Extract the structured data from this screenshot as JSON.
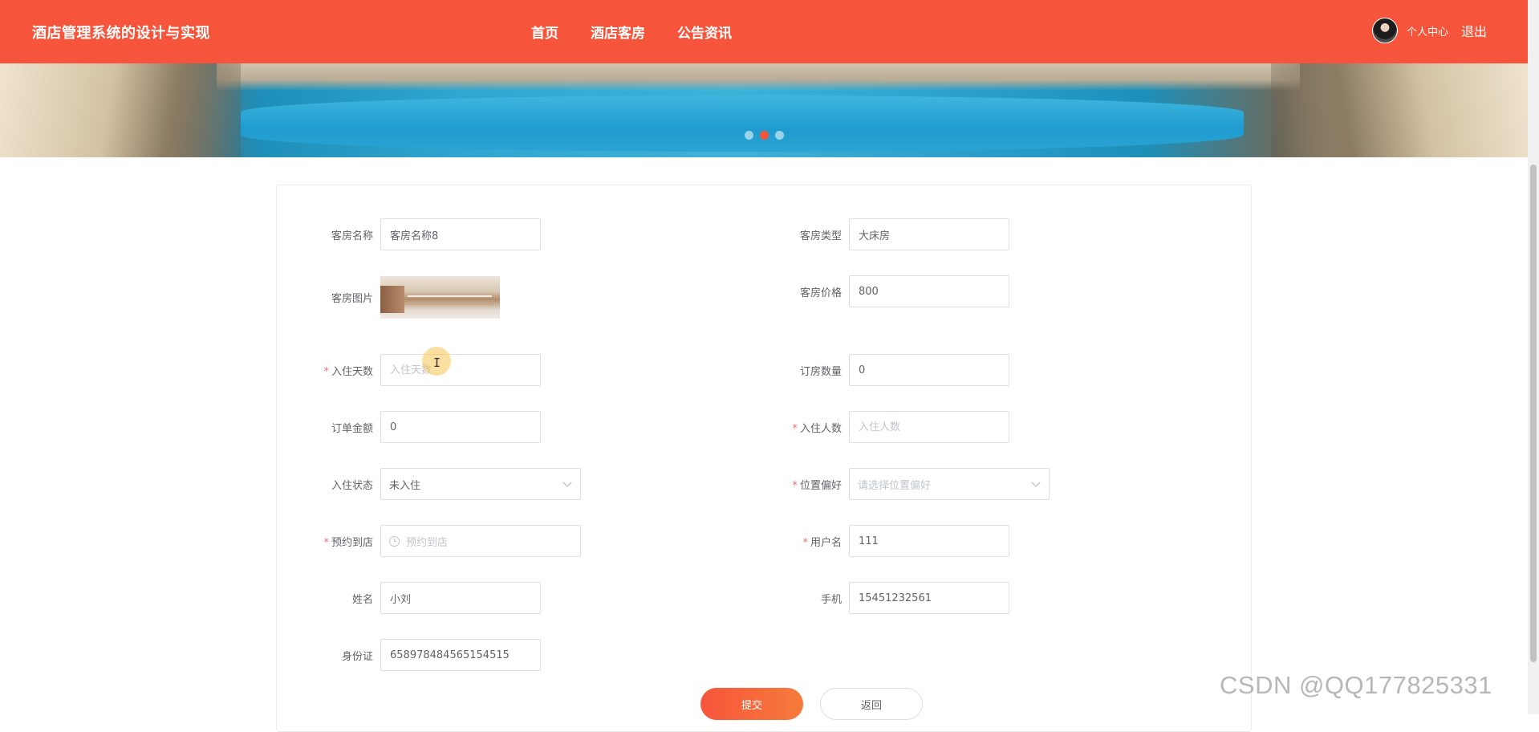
{
  "header": {
    "title": "酒店管理系统的设计与实现",
    "nav": [
      "首页",
      "酒店客房",
      "公告资讯"
    ],
    "user_center": "个人中心",
    "logout": "退出"
  },
  "colors": {
    "primary": "#f6553b",
    "required": "#f56c6c",
    "border": "#dcdfe6",
    "placeholder": "#c0c4cc"
  },
  "form": {
    "room_name": {
      "label": "客房名称",
      "value": "客房名称8"
    },
    "room_type": {
      "label": "客房类型",
      "value": "大床房"
    },
    "room_image": {
      "label": "客房图片"
    },
    "room_price": {
      "label": "客房价格",
      "value": "800"
    },
    "stay_days": {
      "label": "入住天数",
      "placeholder": "入住天数",
      "required": true
    },
    "booking_count": {
      "label": "订房数量",
      "value": "0"
    },
    "order_amount": {
      "label": "订单金额",
      "value": "0"
    },
    "guest_count": {
      "label": "入住人数",
      "placeholder": "入住人数",
      "required": true
    },
    "checkin_status": {
      "label": "入住状态",
      "value": "未入住"
    },
    "location_pref": {
      "label": "位置偏好",
      "placeholder": "请选择位置偏好",
      "required": true
    },
    "arrival_time": {
      "label": "预约到店",
      "placeholder": "预约到店",
      "required": true
    },
    "username": {
      "label": "用户名",
      "value": "111",
      "required": true
    },
    "name": {
      "label": "姓名",
      "value": "小刘"
    },
    "phone": {
      "label": "手机",
      "value": "15451232561"
    },
    "id_card": {
      "label": "身份证",
      "value": "658978484565154515"
    }
  },
  "buttons": {
    "submit": "提交",
    "back": "返回"
  },
  "carousel": {
    "slides": 3,
    "active": 2
  },
  "watermark": "CSDN @QQ177825331"
}
